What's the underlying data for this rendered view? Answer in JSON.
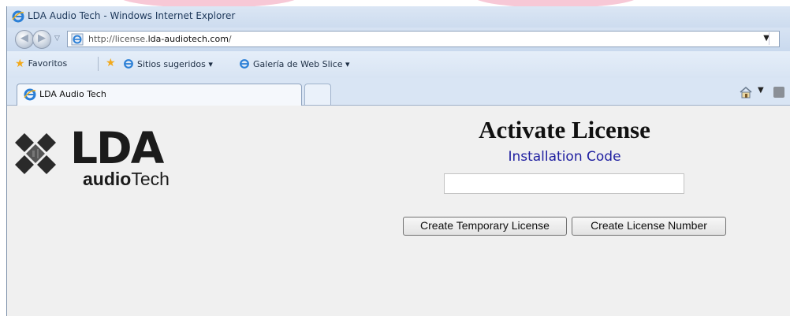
{
  "browser": {
    "window_title": "LDA Audio Tech - Windows Internet Explorer",
    "address": {
      "prefix": "http://license.",
      "domain": "lda-audiotech.com",
      "suffix": "/"
    },
    "favorites_bar": {
      "favorites_label": "Favoritos",
      "items": [
        "Sitios sugeridos ▾",
        "Galería de Web Slice ▾"
      ]
    },
    "tab": {
      "label": "LDA Audio Tech"
    }
  },
  "page": {
    "logo": {
      "mark": "LDA",
      "sub_bold": "audio",
      "sub_regular": "Tech"
    },
    "title": "Activate License",
    "installation_code_label": "Installation Code",
    "installation_code_value": "",
    "buttons": {
      "temporary": "Create Temporary License",
      "number": "Create License Number"
    }
  },
  "colors": {
    "label_blue": "#1f1fa0",
    "chrome_blue": "#dfe9f5",
    "content_bg": "#f0f0f0"
  }
}
